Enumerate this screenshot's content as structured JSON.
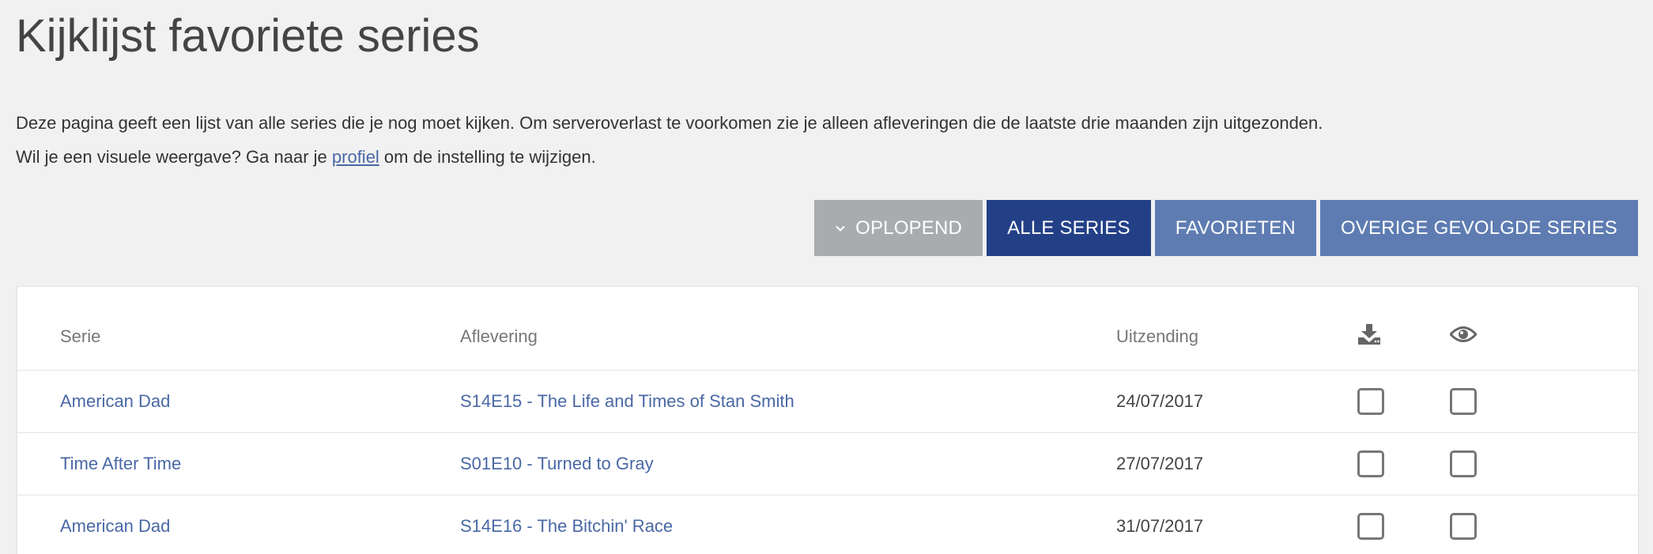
{
  "header": {
    "title": "Kijklijst favoriete series"
  },
  "intro": {
    "line1": "Deze pagina geeft een lijst van alle series die je nog moet kijken. Om serveroverlast te voorkomen zie je alleen afleveringen die de laatste drie maanden zijn uitgezonden.",
    "line2_before": "Wil je een visuele weergave? Ga naar je ",
    "line2_link": "profiel",
    "line2_after": " om de instelling te wijzigen."
  },
  "toolbar": {
    "sort_label": "OPLOPEND",
    "sort_icon": "chevron-down-icon",
    "tabs": [
      {
        "label": "ALLE SERIES",
        "active": true
      },
      {
        "label": "FAVORIETEN",
        "active": false
      },
      {
        "label": "OVERIGE GEVOLGDE SERIES",
        "active": false
      }
    ]
  },
  "table": {
    "columns": {
      "serie": "Serie",
      "episode": "Aflevering",
      "airdate": "Uitzending",
      "download_icon": "download-icon",
      "watched_icon": "eye-icon"
    },
    "rows": [
      {
        "serie": "American Dad",
        "episode": "S14E15 - The Life and Times of Stan Smith",
        "airdate": "24/07/2017",
        "downloaded": false,
        "watched": false
      },
      {
        "serie": "Time After Time",
        "episode": "S01E10 - Turned to Gray",
        "airdate": "27/07/2017",
        "downloaded": false,
        "watched": false
      },
      {
        "serie": "American Dad",
        "episode": "S14E16 - The Bitchin' Race",
        "airdate": "31/07/2017",
        "downloaded": false,
        "watched": false
      }
    ]
  },
  "colors": {
    "background": "#f1f1f1",
    "link": "#4a68a5",
    "button_active": "#234087",
    "button_inactive": "#5e7cb2",
    "button_sort": "#a9acaf"
  }
}
